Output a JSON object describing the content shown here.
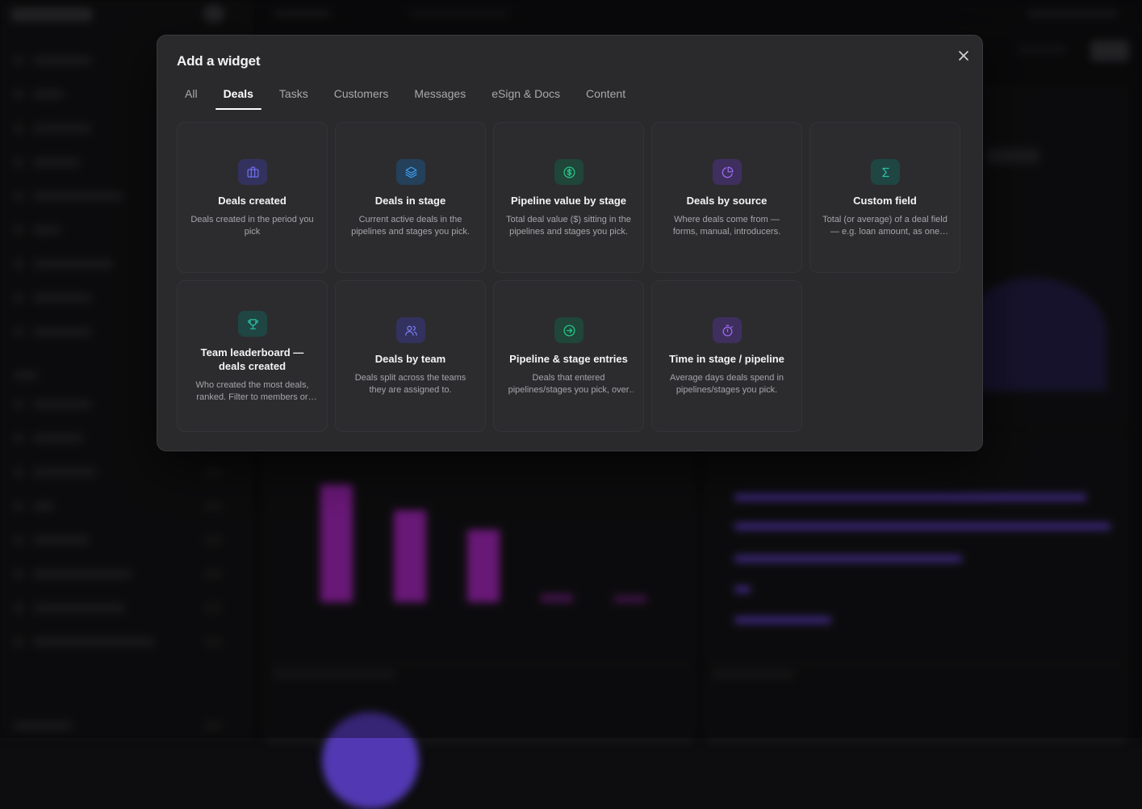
{
  "modal": {
    "title": "Add a widget",
    "close_icon": "close-icon",
    "tabs": [
      {
        "label": "All",
        "active": false
      },
      {
        "label": "Deals",
        "active": true
      },
      {
        "label": "Tasks",
        "active": false
      },
      {
        "label": "Customers",
        "active": false
      },
      {
        "label": "Messages",
        "active": false
      },
      {
        "label": "eSign & Docs",
        "active": false
      },
      {
        "label": "Content",
        "active": false
      }
    ],
    "widgets": [
      {
        "title": "Deals created",
        "desc": "Deals created in the period you pick",
        "icon": "briefcase-icon",
        "color": "#6e6ef0"
      },
      {
        "title": "Deals in stage",
        "desc": "Current active deals in the pipelines and stages you pick.",
        "icon": "layers-icon",
        "color": "#3d9be9"
      },
      {
        "title": "Pipeline value by stage",
        "desc": "Total deal value ($) sitting in the pipelines and stages you pick.",
        "icon": "dollar-circle-icon",
        "color": "#29c28a"
      },
      {
        "title": "Deals by source",
        "desc": "Where deals come from — forms, manual, introducers.",
        "icon": "pie-chart-icon",
        "color": "#9b6af0"
      },
      {
        "title": "Custom field",
        "desc": "Total (or average) of a deal field — e.g. loan amount, as one number",
        "icon": "sigma-icon",
        "color": "#2bbfa6"
      },
      {
        "title": "Team leaderboard — deals created",
        "desc": "Who created the most deals, ranked. Filter to members or teams",
        "icon": "trophy-icon",
        "color": "#2bbfa6"
      },
      {
        "title": "Deals by team",
        "desc": "Deals split across the teams they are assigned to.",
        "icon": "users-icon",
        "color": "#7a7af0"
      },
      {
        "title": "Pipeline & stage entries",
        "desc": "Deals that entered pipelines/stages you pick, over time",
        "icon": "arrow-circle-icon",
        "color": "#29c28a"
      },
      {
        "title": "Time in stage / pipeline",
        "desc": "Average days deals spend in pipelines/stages you pick.",
        "icon": "stopwatch-icon",
        "color": "#9b6af0"
      }
    ]
  }
}
